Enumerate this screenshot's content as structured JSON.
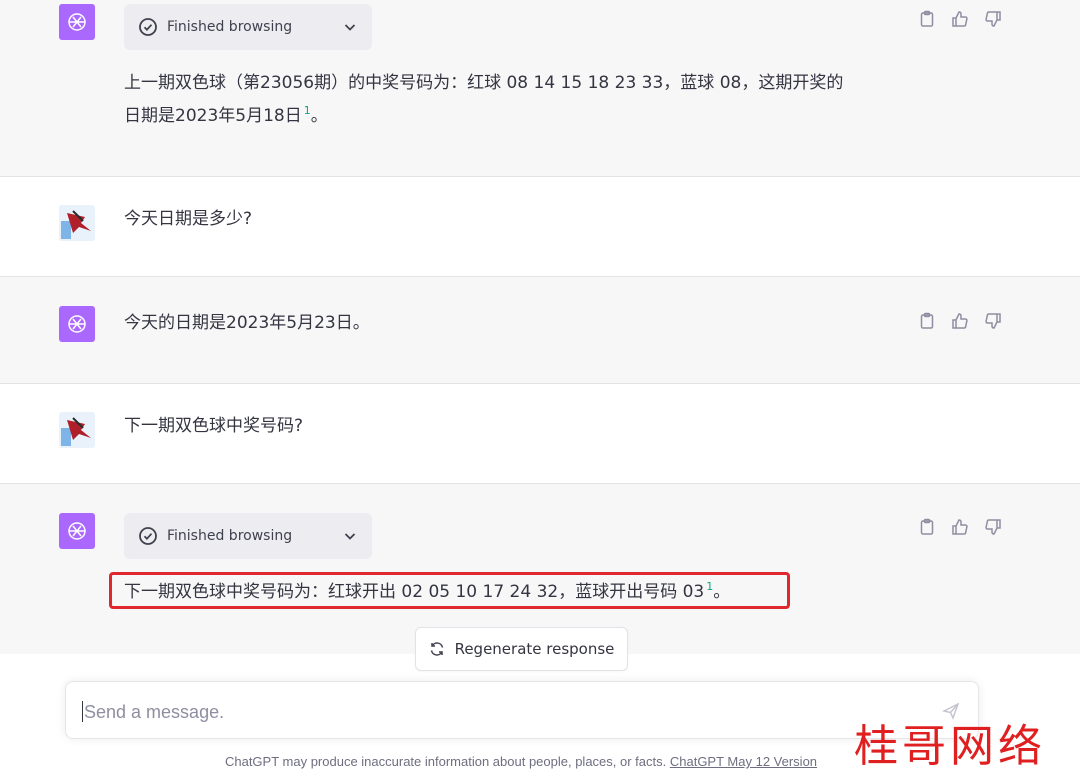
{
  "colors": {
    "gpt_avatar": "#ab68ff",
    "citation": "#10a37f",
    "highlight_box": "#e0262e",
    "watermark": "#e02020"
  },
  "icons": {
    "assistant_avatar": "openai-logo-icon",
    "user_avatar": "user-avatar-icon",
    "browsing_status": "check-circle-icon",
    "expand": "chevron-down-icon",
    "copy": "clipboard-icon",
    "like": "thumbs-up-icon",
    "dislike": "thumbs-down-icon",
    "regenerate": "refresh-icon",
    "send": "send-icon"
  },
  "conversation": [
    {
      "role": "assistant",
      "browsing_label": "Finished browsing",
      "text_line1": "上一期双色球（第23056期）的中奖号码为：红球 08 14 15 18 23 33，蓝球 08，这期开奖的",
      "text_line2": "日期是2023年5月18日",
      "citation": "1",
      "text_tail": "。"
    },
    {
      "role": "user",
      "text": "今天日期是多少?"
    },
    {
      "role": "assistant",
      "text": "今天的日期是2023年5月23日。"
    },
    {
      "role": "user",
      "text": "下一期双色球中奖号码?"
    },
    {
      "role": "assistant",
      "browsing_label": "Finished browsing",
      "text": "下一期双色球中奖号码为：红球开出 02 05 10 17 24 32，蓝球开出号码 03",
      "citation": "1",
      "text_tail": "。"
    }
  ],
  "regenerate_label": "Regenerate response",
  "composer": {
    "placeholder": "Send a message."
  },
  "footer": {
    "text": "ChatGPT may produce inaccurate information about people, places, or facts. ",
    "link": "ChatGPT May 12 Version"
  },
  "watermark": "桂哥网络"
}
